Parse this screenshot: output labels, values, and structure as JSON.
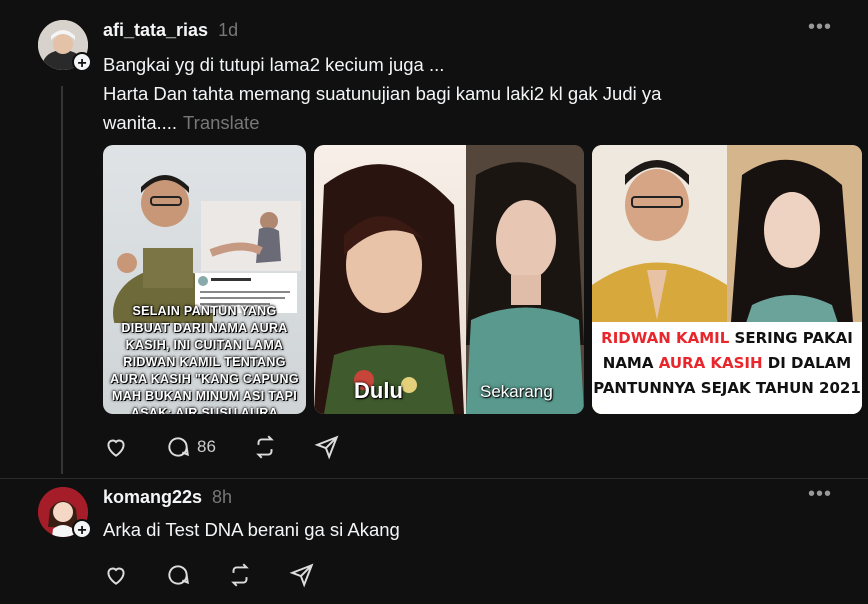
{
  "posts": [
    {
      "username": "afi_tata_rias",
      "time": "1d",
      "text_line1": "Bangkai yg di tutupi lama2 kecium juga ...",
      "text_line2": "Harta Dan tahta memang suatunujian bagi kamu laki2 kl gak Judi ya",
      "text_line3": "wanita....",
      "translate": "Translate",
      "images": {
        "img1_caption": "SELAIN PANTUN YANG DIBUAT DARI NAMA AURA KASIH, INI CUITAN LAMA RIDWAN KAMIL TENTANG AURA KASIH \"KANG CAPUNG MAH BUKAN MINUM ASI TAPI ASAK: AIR SUSU AURA",
        "img2_label_left": "Dulu",
        "img2_label_right": "Sekarang",
        "img3_line1_a": "RIDWAN KAMIL",
        "img3_line1_b": " SERING PAKAI",
        "img3_line2_a": "NAMA ",
        "img3_line2_b": "AURA KASIH",
        "img3_line2_c": " DI DALAM",
        "img3_line3": "PANTUNNYA SEJAK TAHUN 2021"
      },
      "reply_count": "86"
    },
    {
      "username": "komang22s",
      "time": "8h",
      "text_line1": "Arka di Test DNA berani ga si Akang"
    }
  ],
  "icons": {
    "like": "heart-icon",
    "reply": "comment-icon",
    "repost": "repost-icon",
    "share": "send-icon",
    "more": "more-icon",
    "follow": "plus-icon"
  },
  "colors": {
    "background": "#101010",
    "text": "#f3f5f7",
    "muted": "#777777",
    "accent_red": "#e8262b"
  }
}
